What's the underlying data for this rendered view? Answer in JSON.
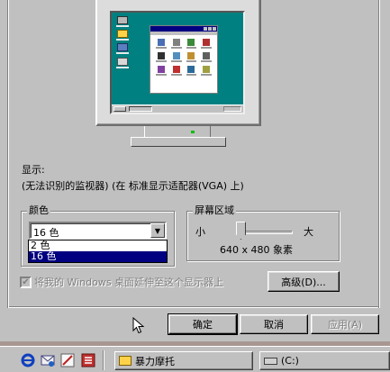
{
  "display": {
    "heading": "显示:",
    "description": "(无法识别的监视器) (在 标准显示适配器(VGA) 上)"
  },
  "colors": {
    "group_title": "颜色",
    "selected_value": "16 色",
    "options": [
      "2 色",
      "16 色"
    ],
    "selected_option": "16 色"
  },
  "screen_area": {
    "group_title": "屏幕区域",
    "min_label": "小",
    "max_label": "大",
    "resolution": "640 x 480 象素",
    "slider_level": 0
  },
  "extend_checkbox": {
    "label": "将我的 Windows 桌面延伸至这个显示器上",
    "checked": true,
    "enabled": false
  },
  "buttons": {
    "advanced": "高级(D)...",
    "ok": "确定",
    "cancel": "取消",
    "apply": "应用(A)"
  },
  "taskbar": {
    "quick_launch": [
      "ie-icon",
      "outlook-express-icon",
      "channel-icon",
      "antivirus-icon"
    ],
    "window_task": "暴力摩托",
    "drive_task": "(C:)"
  }
}
